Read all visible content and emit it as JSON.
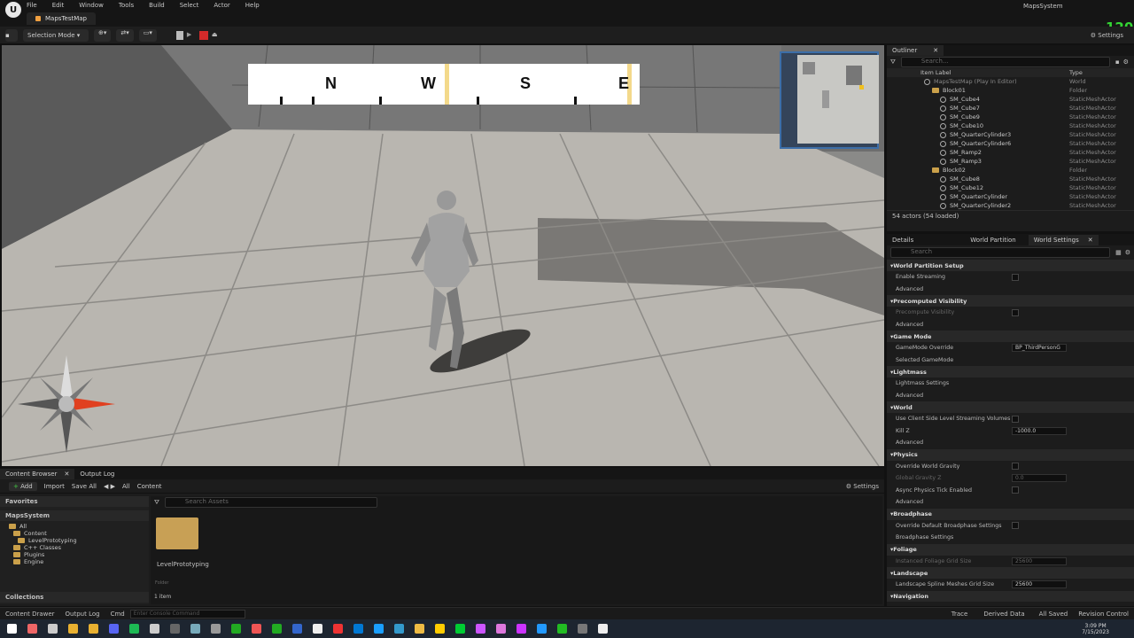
{
  "app": {
    "project": "MapsSystem",
    "map_tab": "MapsTestMap",
    "fps": "120",
    "menu": [
      "File",
      "Edit",
      "Window",
      "Tools",
      "Build",
      "Select",
      "Actor",
      "Help"
    ]
  },
  "toolbar": {
    "mode": "Selection Mode",
    "settings": "Settings"
  },
  "compass": {
    "labels": [
      "N",
      "W",
      "S",
      "E"
    ]
  },
  "outliner": {
    "tab": "Outliner",
    "search_placeholder": "Search...",
    "col_label": "Item Label",
    "col_type": "Type",
    "rows": [
      {
        "label": "MapsTestMap (Play In Editor)",
        "type": "World",
        "indent": 0,
        "icon": "world-icon"
      },
      {
        "label": "Block01",
        "type": "Folder",
        "indent": 1,
        "icon": "folder-icon"
      },
      {
        "label": "SM_Cube4",
        "type": "StaticMeshActor",
        "indent": 2,
        "icon": "mesh-icon"
      },
      {
        "label": "SM_Cube7",
        "type": "StaticMeshActor",
        "indent": 2,
        "icon": "mesh-icon"
      },
      {
        "label": "SM_Cube9",
        "type": "StaticMeshActor",
        "indent": 2,
        "icon": "mesh-icon"
      },
      {
        "label": "SM_Cube10",
        "type": "StaticMeshActor",
        "indent": 2,
        "icon": "mesh-icon"
      },
      {
        "label": "SM_QuarterCylinder3",
        "type": "StaticMeshActor",
        "indent": 2,
        "icon": "mesh-icon"
      },
      {
        "label": "SM_QuarterCylinder6",
        "type": "StaticMeshActor",
        "indent": 2,
        "icon": "mesh-icon"
      },
      {
        "label": "SM_Ramp2",
        "type": "StaticMeshActor",
        "indent": 2,
        "icon": "mesh-icon"
      },
      {
        "label": "SM_Ramp3",
        "type": "StaticMeshActor",
        "indent": 2,
        "icon": "mesh-icon"
      },
      {
        "label": "Block02",
        "type": "Folder",
        "indent": 1,
        "icon": "folder-icon"
      },
      {
        "label": "SM_Cube8",
        "type": "StaticMeshActor",
        "indent": 2,
        "icon": "mesh-icon"
      },
      {
        "label": "SM_Cube12",
        "type": "StaticMeshActor",
        "indent": 2,
        "icon": "mesh-icon"
      },
      {
        "label": "SM_QuarterCylinder",
        "type": "StaticMeshActor",
        "indent": 2,
        "icon": "mesh-icon"
      },
      {
        "label": "SM_QuarterCylinder2",
        "type": "StaticMeshActor",
        "indent": 2,
        "icon": "mesh-icon"
      }
    ],
    "footer": "54 actors (54 loaded)"
  },
  "details": {
    "tabs": [
      "Details",
      "World Partition",
      "World Settings"
    ],
    "search_placeholder": "Search",
    "items": [
      {
        "kind": "section",
        "label": "World Partition Setup"
      },
      {
        "kind": "prop",
        "label": "Enable Streaming",
        "ctl": "check"
      },
      {
        "kind": "prop",
        "label": "Advanced",
        "ctl": ""
      },
      {
        "kind": "section",
        "label": "Precomputed Visibility"
      },
      {
        "kind": "prop",
        "label": "Precompute Visibility",
        "ctl": "check",
        "dim": true
      },
      {
        "kind": "prop",
        "label": "Advanced",
        "ctl": ""
      },
      {
        "kind": "section",
        "label": "Game Mode"
      },
      {
        "kind": "prop",
        "label": "GameMode Override",
        "ctl": "value",
        "value": "BP_ThirdPersonG"
      },
      {
        "kind": "prop",
        "label": "Selected GameMode",
        "ctl": ""
      },
      {
        "kind": "section",
        "label": "Lightmass"
      },
      {
        "kind": "prop",
        "label": "Lightmass Settings",
        "ctl": ""
      },
      {
        "kind": "prop",
        "label": "Advanced",
        "ctl": ""
      },
      {
        "kind": "section",
        "label": "World"
      },
      {
        "kind": "prop",
        "label": "Use Client Side Level Streaming Volumes",
        "ctl": "check"
      },
      {
        "kind": "prop",
        "label": "Kill Z",
        "ctl": "value",
        "value": "-1000.0"
      },
      {
        "kind": "prop",
        "label": "Advanced",
        "ctl": ""
      },
      {
        "kind": "section",
        "label": "Physics"
      },
      {
        "kind": "prop",
        "label": "Override World Gravity",
        "ctl": "check"
      },
      {
        "kind": "prop",
        "label": "Global Gravity Z",
        "ctl": "value",
        "value": "0.0",
        "dim": true
      },
      {
        "kind": "prop",
        "label": "Async Physics Tick Enabled",
        "ctl": "check"
      },
      {
        "kind": "prop",
        "label": "Advanced",
        "ctl": ""
      },
      {
        "kind": "section",
        "label": "Broadphase"
      },
      {
        "kind": "prop",
        "label": "Override Default Broadphase Settings",
        "ctl": "check"
      },
      {
        "kind": "prop",
        "label": "Broadphase Settings",
        "ctl": ""
      },
      {
        "kind": "section",
        "label": "Foliage"
      },
      {
        "kind": "prop",
        "label": "Instanced Foliage Grid Size",
        "ctl": "value",
        "value": "25600",
        "dim": true
      },
      {
        "kind": "section",
        "label": "Landscape"
      },
      {
        "kind": "prop",
        "label": "Landscape Spline Meshes Grid Size",
        "ctl": "value",
        "value": "25600"
      },
      {
        "kind": "section",
        "label": "Navigation"
      }
    ]
  },
  "content_browser": {
    "tabs": [
      "Content Browser",
      "Output Log"
    ],
    "add": "Add",
    "import": "Import",
    "save_all": "Save All",
    "path": [
      "All",
      "Content"
    ],
    "settings": "Settings",
    "favorites": "Favorites",
    "project": "MapsSystem",
    "tree": [
      "All",
      "Content",
      "LevelPrototyping",
      "C++ Classes",
      "Plugins",
      "Engine"
    ],
    "search_placeholder": "Search Assets",
    "asset_name": "LevelPrototyping",
    "asset_type": "Folder",
    "count": "1 item",
    "collections": "Collections"
  },
  "status": {
    "content_drawer": "Content Drawer",
    "output_log": "Output Log",
    "cmd": "Cmd",
    "console_placeholder": "Enter Console Command",
    "trace": "Trace",
    "derived": "Derived Data",
    "saved": "All Saved",
    "revision": "Revision Control"
  },
  "taskbar": {
    "time": "3:09 PM",
    "date": "7/15/2023"
  }
}
